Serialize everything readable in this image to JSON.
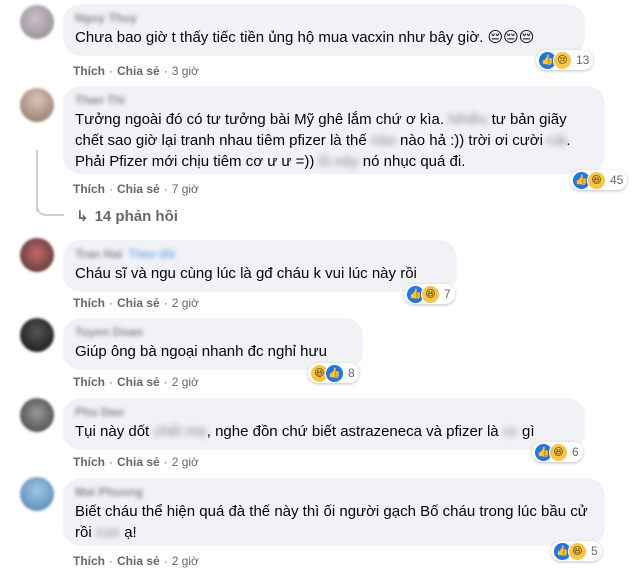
{
  "colors": {
    "link": "#65676b",
    "bubble": "#f0f2f5",
    "like": "#1877f2",
    "haha": "#f7c744"
  },
  "action_labels": {
    "like": "Thích",
    "share": "Chia sẻ"
  },
  "comments": [
    {
      "author": "Nguy Thuy",
      "text": "Chưa bao giờ t thấy tiếc tiền ủng hộ mua vacxin như bây giờ. 😔😔😔",
      "time": "3 giờ",
      "reactions": [
        "like",
        "sad"
      ],
      "count": "13"
    },
    {
      "author": "Than Thi",
      "text_parts": [
        "Tưởng ngoài đó có tư tưởng bài Mỹ ghê lắm chứ ơ kìa.",
        "Nhiều",
        "tư bản giãy chết sao giờ lại tranh nhau tiêm pfizer là thế",
        "nào",
        "nào hả :)) trời ơi cười",
        "cái",
        ". Phải Pfizer mới chịu tiêm cơ ư ư =))",
        "lũ này",
        "nó nhục quá đi."
      ],
      "time": "7 giờ",
      "reactions": [
        "like",
        "haha"
      ],
      "count": "45",
      "replies": "14 phản hồi"
    },
    {
      "author": "Tran Hai",
      "follow": "Theo dõi",
      "text": "Cháu sĩ và ngu cùng lúc là gđ cháu k vui lúc này rồi",
      "time": "2 giờ",
      "reactions": [
        "like",
        "haha"
      ],
      "count": "7"
    },
    {
      "author": "Tuyen Doan",
      "text": "Giúp ông bà ngoại nhanh đc nghỉ hưu",
      "time": "2 giờ",
      "reactions": [
        "haha",
        "like"
      ],
      "count": "8"
    },
    {
      "author": "Phu Dao",
      "text_parts": [
        "Tụi này dốt",
        "chết mẹ",
        ", nghe đồn chứ biết astrazeneca và pfizer là",
        "cc",
        "gì"
      ],
      "time": "2 giờ",
      "reactions": [
        "like",
        "haha"
      ],
      "count": "6"
    },
    {
      "author": "Mai Phuong",
      "text_parts": [
        "Biết cháu thể hiện quá đà thế này thì ối người gạch Bố cháu trong lúc bầu cử rồi",
        "con",
        "ạ!"
      ],
      "time": "2 giờ",
      "reactions": [
        "like",
        "haha"
      ],
      "count": "5"
    }
  ]
}
